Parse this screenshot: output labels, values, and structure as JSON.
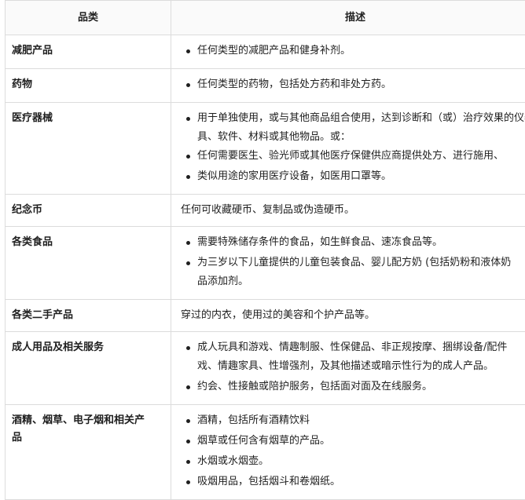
{
  "header": {
    "col1": "品类",
    "col2": "描述"
  },
  "rows": [
    {
      "category": "减肥产品",
      "items": [
        "任何类型的减肥产品和健身补剂。"
      ]
    },
    {
      "category": "药物",
      "items": [
        "任何类型的药物，包括处方药和非处方药。"
      ]
    },
    {
      "category": "医疗器械",
      "items": [
        "用于单独使用，或与其他商品组合使用，达到诊断和（或）治疗效果的仪器、器",
        "具、软件、材料或其他物品。或：",
        "任何需要医生、验光师或其他医疗保健供应商提供处方、进行施用、",
        "类似用途的家用医疗设备，如医用口罩等。"
      ]
    },
    {
      "category": "纪念币",
      "text": "任何可收藏硬币、复制品或伪造硬币。"
    },
    {
      "category": "各类食品",
      "items": [
        "需要特殊储存条件的食品，如生鲜食品、速冻食品等。",
        "为三岁以下儿童提供的儿童包装食品、婴儿配方奶 (包括奶粉和液体奶",
        "品添加剂。"
      ]
    },
    {
      "category": "各类二手产品",
      "text": "穿过的内衣，使用过的美容和个护产品等。"
    },
    {
      "category": "成人用品及相关服务",
      "items": [
        "成人玩具和游戏、情趣制服、性保健品、非正规按摩、捆绑设备/配件",
        "戏、情趣家具、性增强剂，及其他描述或暗示性行为的成人产品。",
        "约会、性接触或陪护服务，包括面对面及在线服务。"
      ]
    },
    {
      "category_line1": "酒精、烟草、电子烟和相关产",
      "category_line2": "品",
      "items": [
        "酒精，包括所有酒精饮料",
        "烟草或任何含有烟草的产品。",
        "水烟或水烟壶。",
        "吸烟用品，包括烟斗和卷烟纸。"
      ]
    }
  ]
}
